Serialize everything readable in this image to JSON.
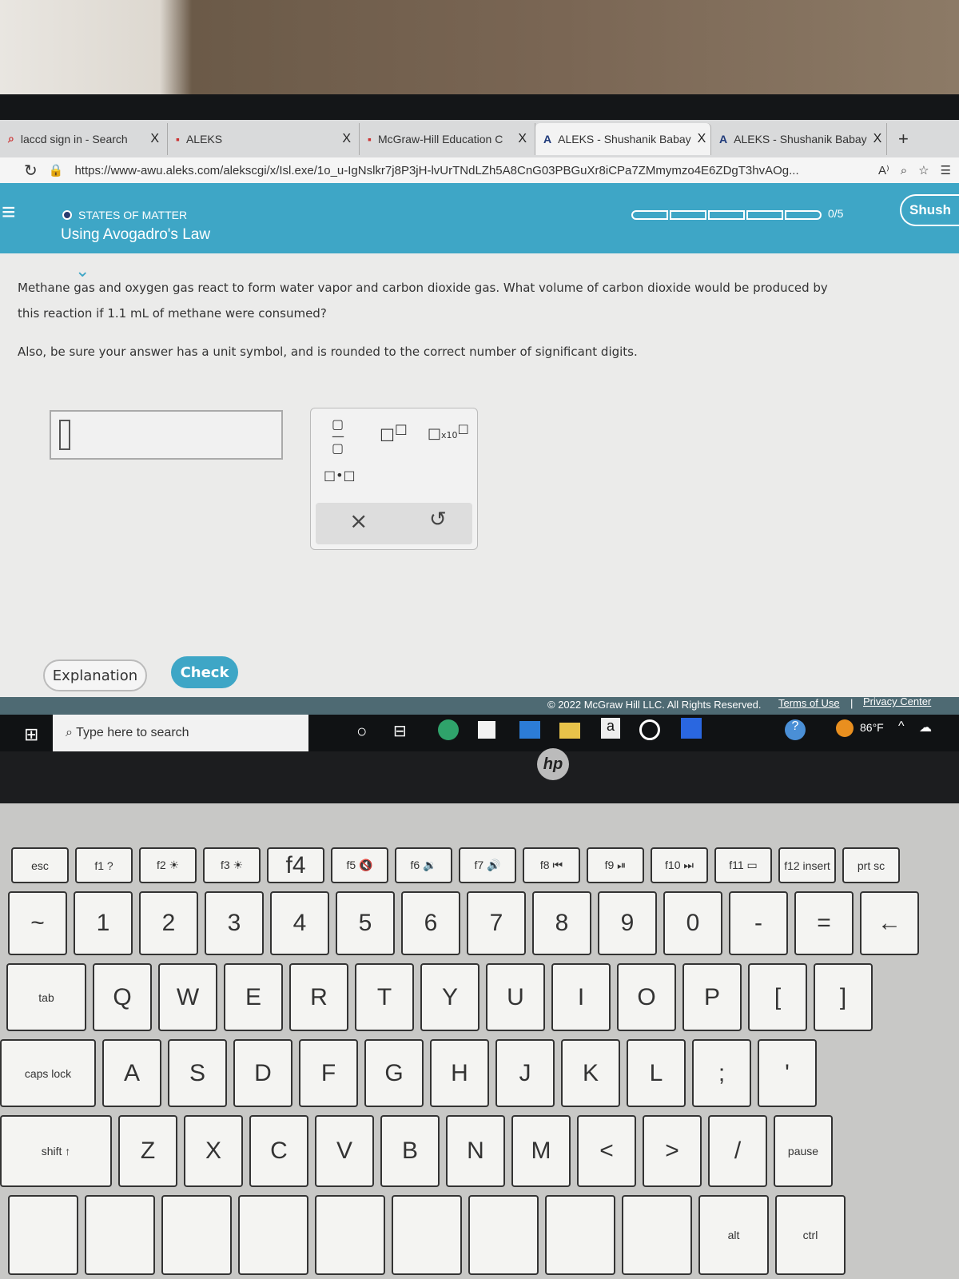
{
  "browser": {
    "tabs": [
      {
        "label": "laccd sign in - Search",
        "icon": "search-icon"
      },
      {
        "label": "ALEKS",
        "icon": "aleks-logo-icon"
      },
      {
        "label": "McGraw-Hill Education C",
        "icon": "mcgraw-hill-icon"
      },
      {
        "label": "ALEKS - Shushanik Babay",
        "icon": "aleks-a-icon",
        "active": true
      },
      {
        "label": "ALEKS - Shushanik Babay",
        "icon": "aleks-a-icon"
      }
    ],
    "close_glyph": "X",
    "new_tab": "+",
    "url": "https://www-awu.aleks.com/alekscgi/x/Isl.exe/1o_u-IgNslkr7j8P3jH-lvUrTNdLZh5A8CnG03PBGuXr8iCPa7ZMmymzo4E6ZDgT3hvAOg...",
    "read_aloud": "A⁾"
  },
  "header": {
    "topic": "STATES OF MATTER",
    "title": "Using Avogadro's Law",
    "progress_text": "0/5",
    "progress": 0,
    "user": "Shush",
    "accent": "#3ea6c6"
  },
  "question": {
    "line1": "Methane gas and oxygen gas react to form water vapor and carbon dioxide gas. What volume of carbon dioxide would be produced by",
    "line2": "this reaction if 1.1 mL of methane were consumed?",
    "line3": "Also, be sure your answer has a unit symbol, and is rounded to the correct number of significant digits."
  },
  "answer": {
    "value": ""
  },
  "pad": {
    "x10": "x10",
    "clear": "×",
    "undo": "↺"
  },
  "buttons": {
    "explanation": "Explanation",
    "check": "Check"
  },
  "footer": {
    "copyright": "© 2022 McGraw Hill LLC. All Rights Reserved.",
    "terms": "Terms of Use",
    "sep": "|",
    "privacy": "Privacy Center"
  },
  "taskbar": {
    "search_placeholder": "Type here to search",
    "temperature": "86°F",
    "amazon": "a"
  },
  "laptop": {
    "brand": "hp"
  },
  "keyboard": {
    "rows": [
      [
        "esc",
        "f1 ?",
        "f2 ☀",
        "f3 ☀",
        "f4",
        "f5 🔇",
        "f6 🔉",
        "f7 🔊",
        "f8 ⏮",
        "f9 ⏯",
        "f10 ⏭",
        "f11 ▭",
        "f12 insert",
        "prt sc"
      ],
      [
        "~",
        "1",
        "2",
        "3",
        "4",
        "5",
        "6",
        "7",
        "8",
        "9",
        "0",
        "-",
        "=",
        "←"
      ],
      [
        "tab",
        "Q",
        "W",
        "E",
        "R",
        "T",
        "Y",
        "U",
        "I",
        "O",
        "P",
        "[",
        "]"
      ],
      [
        "caps lock",
        "A",
        "S",
        "D",
        "F",
        "G",
        "H",
        "J",
        "K",
        "L",
        ";",
        "'"
      ],
      [
        "shift ↑",
        "Z",
        "X",
        "C",
        "V",
        "B",
        "N",
        "M",
        "<",
        ">",
        "/",
        "pause"
      ],
      [
        "",
        "",
        "",
        "",
        "",
        "",
        "",
        "",
        "",
        "alt",
        "ctrl"
      ]
    ]
  }
}
